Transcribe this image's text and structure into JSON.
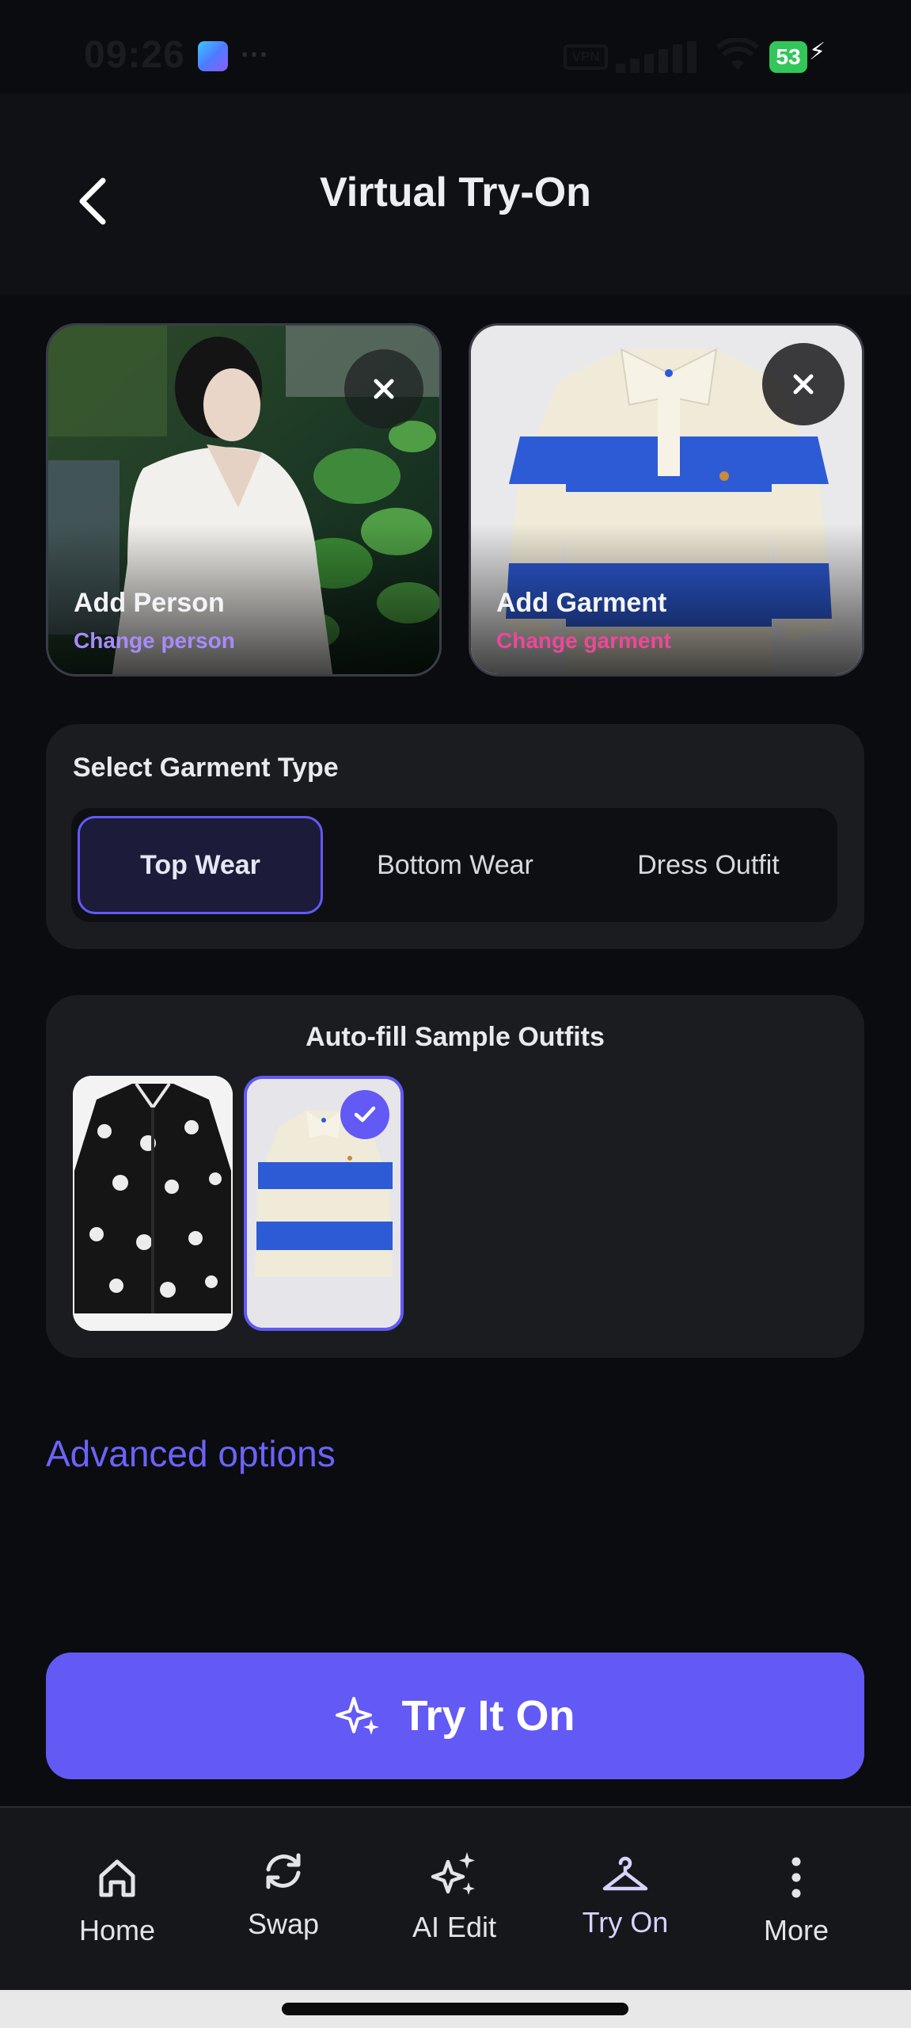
{
  "status_bar": {
    "time": "09:26",
    "vpn_label": "VPN",
    "battery": "53"
  },
  "header": {
    "title": "Virtual Try-On",
    "back_icon": "chevron-left-icon"
  },
  "uploads": {
    "person": {
      "title": "Add Person",
      "subtitle": "Change person",
      "subtitle_color": "#a78bfa"
    },
    "garment": {
      "title": "Add Garment",
      "subtitle": "Change garment",
      "subtitle_color": "#ec4899"
    }
  },
  "garment_type": {
    "heading": "Select Garment Type",
    "options": [
      "Top Wear",
      "Bottom Wear",
      "Dress Outfit"
    ],
    "selected": "Top Wear"
  },
  "samples": {
    "heading": "Auto-fill Sample Outfits",
    "items": [
      {
        "name": "black palm-print shirt",
        "selected": false
      },
      {
        "name": "blue and cream striped polo",
        "selected": true
      }
    ]
  },
  "advanced": {
    "label": "Advanced options"
  },
  "primary_action": {
    "label": "Try It On",
    "color": "#6359f5"
  },
  "bottom_nav": {
    "items": [
      {
        "label": "Home",
        "icon": "home-icon"
      },
      {
        "label": "Swap",
        "icon": "swap-icon"
      },
      {
        "label": "AI Edit",
        "icon": "sparkles-icon"
      },
      {
        "label": "Try On",
        "icon": "hanger-icon",
        "active": true
      },
      {
        "label": "More",
        "icon": "more-vertical-icon"
      }
    ]
  }
}
